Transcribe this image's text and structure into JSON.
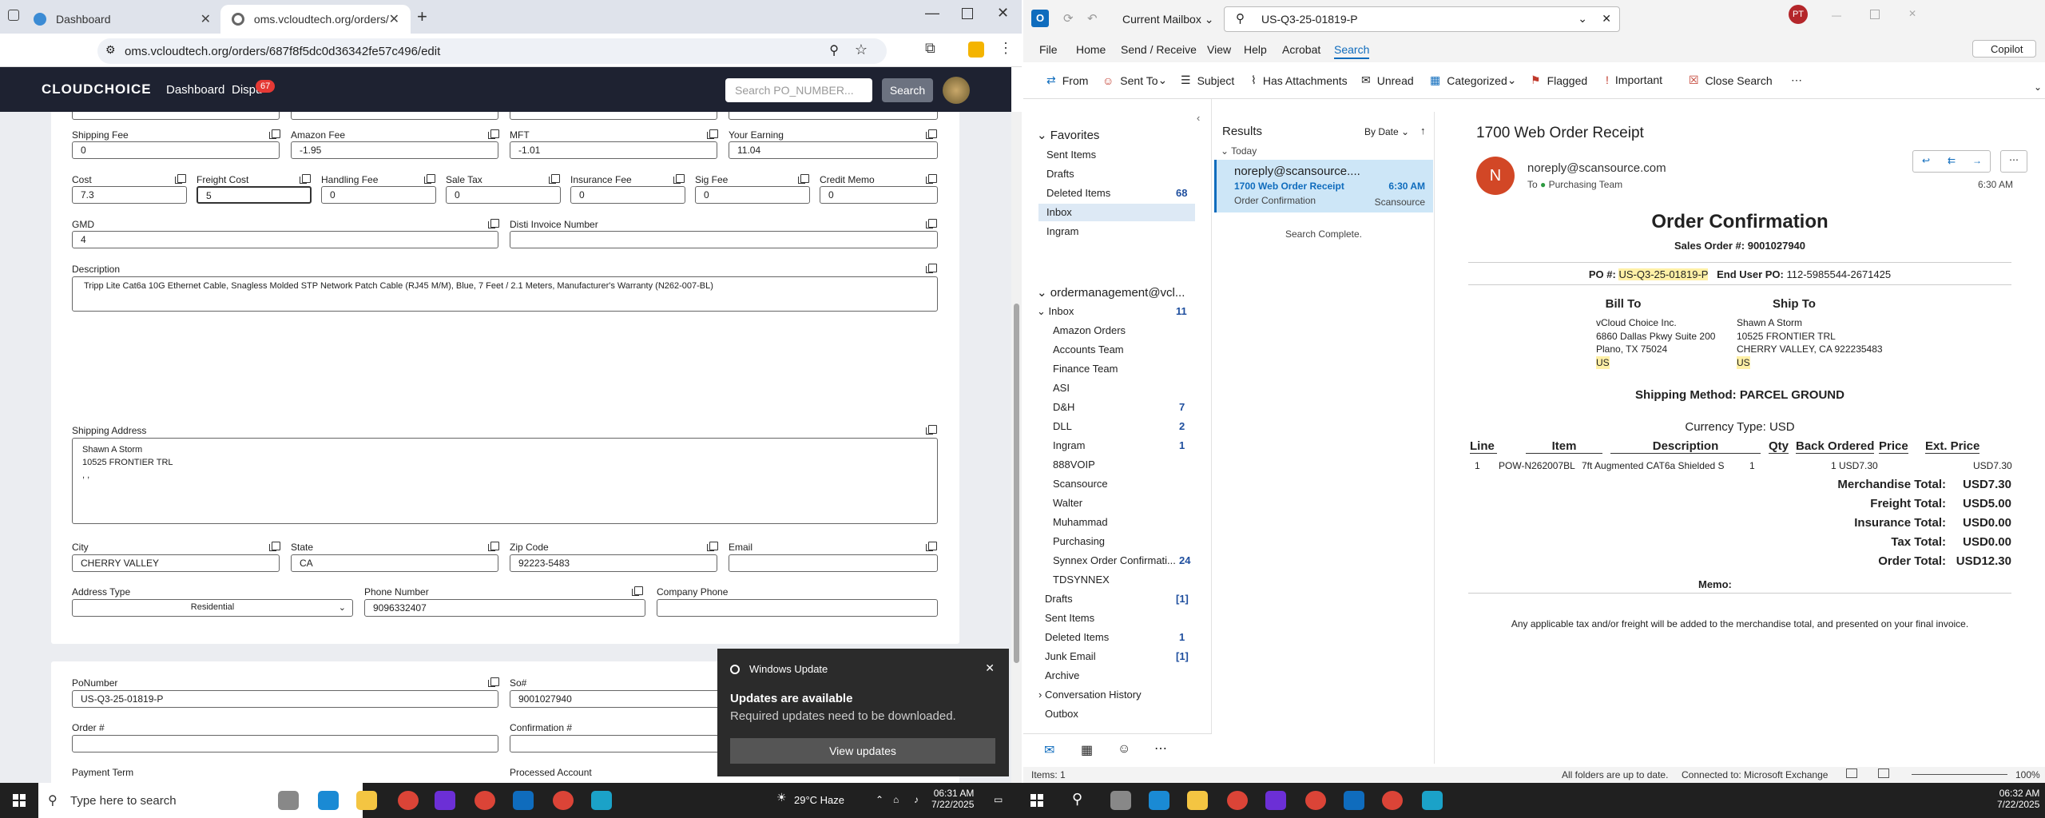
{
  "browser": {
    "tabs": [
      {
        "title": "Dashboard"
      },
      {
        "title": "oms.vcloudtech.org/orders/687"
      }
    ],
    "url": "oms.vcloudtech.org/orders/687f8f5dc0d36342fe57c496/edit"
  },
  "site": {
    "logo": "CLOUDCHOICE",
    "nav": {
      "dashboard": "Dashboard",
      "disputes": "Dispu",
      "disputes_badge": "67"
    },
    "search_placeholder": "Search PO_NUMBER...",
    "search_button": "Search"
  },
  "form": {
    "row1": [
      {
        "label": "Shipping Fee",
        "value": "0"
      },
      {
        "label": "Amazon Fee",
        "value": "-1.95"
      },
      {
        "label": "MFT",
        "value": "-1.01"
      },
      {
        "label": "Your Earning",
        "value": "11.04"
      }
    ],
    "row2": [
      {
        "label": "Cost",
        "value": "7.3"
      },
      {
        "label": "Freight Cost",
        "value": "5"
      },
      {
        "label": "Handling Fee",
        "value": "0"
      },
      {
        "label": "Sale Tax",
        "value": "0"
      },
      {
        "label": "Insurance Fee",
        "value": "0"
      },
      {
        "label": "Sig Fee",
        "value": "0"
      },
      {
        "label": "Credit Memo",
        "value": "0"
      }
    ],
    "gmd": {
      "label": "GMD",
      "value": "4"
    },
    "disti": {
      "label": "Disti Invoice Number",
      "value": ""
    },
    "description": {
      "label": "Description",
      "value": "Tripp Lite Cat6a 10G Ethernet Cable, Snagless Molded STP Network Patch Cable (RJ45 M/M), Blue, 7 Feet / 2.1 Meters, Manufacturer's Warranty (N262-007-BL)"
    },
    "shipping_address": {
      "label": "Shipping Address",
      "lines": [
        "Shawn A Storm",
        "10525 FRONTIER TRL",
        ", ,"
      ]
    },
    "city": {
      "label": "City",
      "value": "CHERRY VALLEY"
    },
    "state": {
      "label": "State",
      "value": "CA"
    },
    "zip": {
      "label": "Zip Code",
      "value": "92223-5483"
    },
    "email": {
      "label": "Email",
      "value": ""
    },
    "address_type": {
      "label": "Address Type",
      "value": "Residential"
    },
    "phone": {
      "label": "Phone Number",
      "value": "9096332407"
    },
    "company_phone": {
      "label": "Company Phone",
      "value": ""
    },
    "ponumber": {
      "label": "PoNumber",
      "value": "US-Q3-25-01819-P"
    },
    "so": {
      "label": "So#",
      "value": "9001027940"
    },
    "order": {
      "label": "Order #",
      "value": ""
    },
    "confirmation": {
      "label": "Confirmation #",
      "value": ""
    },
    "payment_term": {
      "label": "Payment Term"
    },
    "processed_account": {
      "label": "Processed Account"
    }
  },
  "toast": {
    "app": "Windows Update",
    "title": "Updates are available",
    "body": "Required updates need to be downloaded.",
    "button": "View updates"
  },
  "outlook": {
    "mailbox": "Current Mailbox",
    "search_query": "US-Q3-25-01819-P",
    "user_initials": "PT",
    "copilot": "Copilot",
    "menu": [
      "File",
      "Home",
      "Send / Receive",
      "View",
      "Help",
      "Acrobat",
      "Search"
    ],
    "ribbon": [
      "From",
      "Sent To",
      "Subject",
      "Has Attachments",
      "Unread",
      "Categorized",
      "Flagged",
      "Important",
      "Close Search"
    ],
    "favorites_label": "Favorites",
    "favorites": [
      {
        "name": "Sent Items",
        "count": ""
      },
      {
        "name": "Drafts",
        "count": ""
      },
      {
        "name": "Deleted Items",
        "count": "68"
      },
      {
        "name": "Inbox",
        "count": ""
      },
      {
        "name": "Ingram",
        "count": ""
      }
    ],
    "account": "ordermanagement@vcl...",
    "inbox_label": "Inbox",
    "inbox_count": "11",
    "subfolders": [
      {
        "name": "Amazon Orders",
        "count": ""
      },
      {
        "name": "Accounts Team",
        "count": ""
      },
      {
        "name": "Finance Team",
        "count": ""
      },
      {
        "name": "ASI",
        "count": ""
      },
      {
        "name": "D&H",
        "count": "7"
      },
      {
        "name": "DLL",
        "count": "2"
      },
      {
        "name": "Ingram",
        "count": "1"
      },
      {
        "name": "888VOIP",
        "count": ""
      },
      {
        "name": "Scansource",
        "count": ""
      },
      {
        "name": "Walter",
        "count": ""
      },
      {
        "name": "Muhammad",
        "count": ""
      },
      {
        "name": "Purchasing",
        "count": ""
      },
      {
        "name": "Synnex Order Confirmati...",
        "count": "24"
      },
      {
        "name": "TDSYNNEX",
        "count": ""
      }
    ],
    "other_folders": [
      {
        "name": "Drafts",
        "count": "[1]"
      },
      {
        "name": "Sent Items",
        "count": ""
      },
      {
        "name": "Deleted Items",
        "count": "1"
      },
      {
        "name": "Junk Email",
        "count": "[1]"
      },
      {
        "name": "Archive",
        "count": ""
      },
      {
        "name": "Conversation History",
        "count": ""
      },
      {
        "name": "Outbox",
        "count": ""
      }
    ],
    "results_label": "Results",
    "sort_label": "By Date",
    "today_label": "Today",
    "message": {
      "from": "noreply@scansource....",
      "subject": "1700 Web Order Receipt",
      "time": "6:30 AM",
      "preview": "Order Confirmation",
      "folder": "Scansource"
    },
    "search_complete": "Search Complete.",
    "reading": {
      "subject": "1700 Web Order Receipt",
      "sender_initial": "N",
      "from": "noreply@scansource.com",
      "to_label": "To",
      "to": "Purchasing Team",
      "time": "6:30 AM",
      "doc_title": "Order Confirmation",
      "sales_order": "Sales Order #:  9001027940",
      "po_label": "PO #:",
      "po": "US-Q3-25-01819-P",
      "end_user_po_label": "End User PO:",
      "end_user_po": "112-5985544-2671425",
      "bill_to_label": "Bill To",
      "bill_to": [
        "vCloud Choice Inc.",
        "6860 Dallas Pkwy Suite 200",
        "Plano, TX 75024",
        "US"
      ],
      "ship_to_label": "Ship To",
      "ship_to": [
        "Shawn A Storm",
        "10525 FRONTIER TRL",
        "CHERRY VALLEY, CA 922235483",
        "US"
      ],
      "shipping_method": "Shipping Method: PARCEL GROUND",
      "currency": "Currency Type: USD",
      "columns": [
        "Line",
        "Item",
        "Description",
        "Qty",
        "Back Ordered",
        "Price",
        "Ext. Price"
      ],
      "line": {
        "line": "1",
        "item": "POW-N262007BL",
        "desc": "7ft Augmented CAT6a Shielded S",
        "qty": "1",
        "bo": "1",
        "price": "USD7.30",
        "ext": "USD7.30"
      },
      "totals": [
        {
          "label": "Merchandise Total:",
          "value": "USD7.30"
        },
        {
          "label": "Freight Total:",
          "value": "USD5.00"
        },
        {
          "label": "Insurance Total:",
          "value": "USD0.00"
        },
        {
          "label": "Tax Total:",
          "value": "USD0.00"
        },
        {
          "label": "Order Total:",
          "value": "USD12.30"
        }
      ],
      "memo": "Memo:",
      "footer": "Any applicable tax and/or freight will be added to the merchandise total, and presented on your final invoice."
    },
    "status": {
      "items": "Items: 1",
      "sync": "All folders are up to date.",
      "connected": "Connected to: Microsoft Exchange",
      "zoom": "100%"
    }
  },
  "taskbar": {
    "search_placeholder": "Type here to search",
    "weather": "29°C  Haze",
    "clock_left": {
      "time": "06:31 AM",
      "date": "7/22/2025"
    },
    "clock_right": {
      "time": "06:32 AM",
      "date": "7/22/2025"
    }
  }
}
